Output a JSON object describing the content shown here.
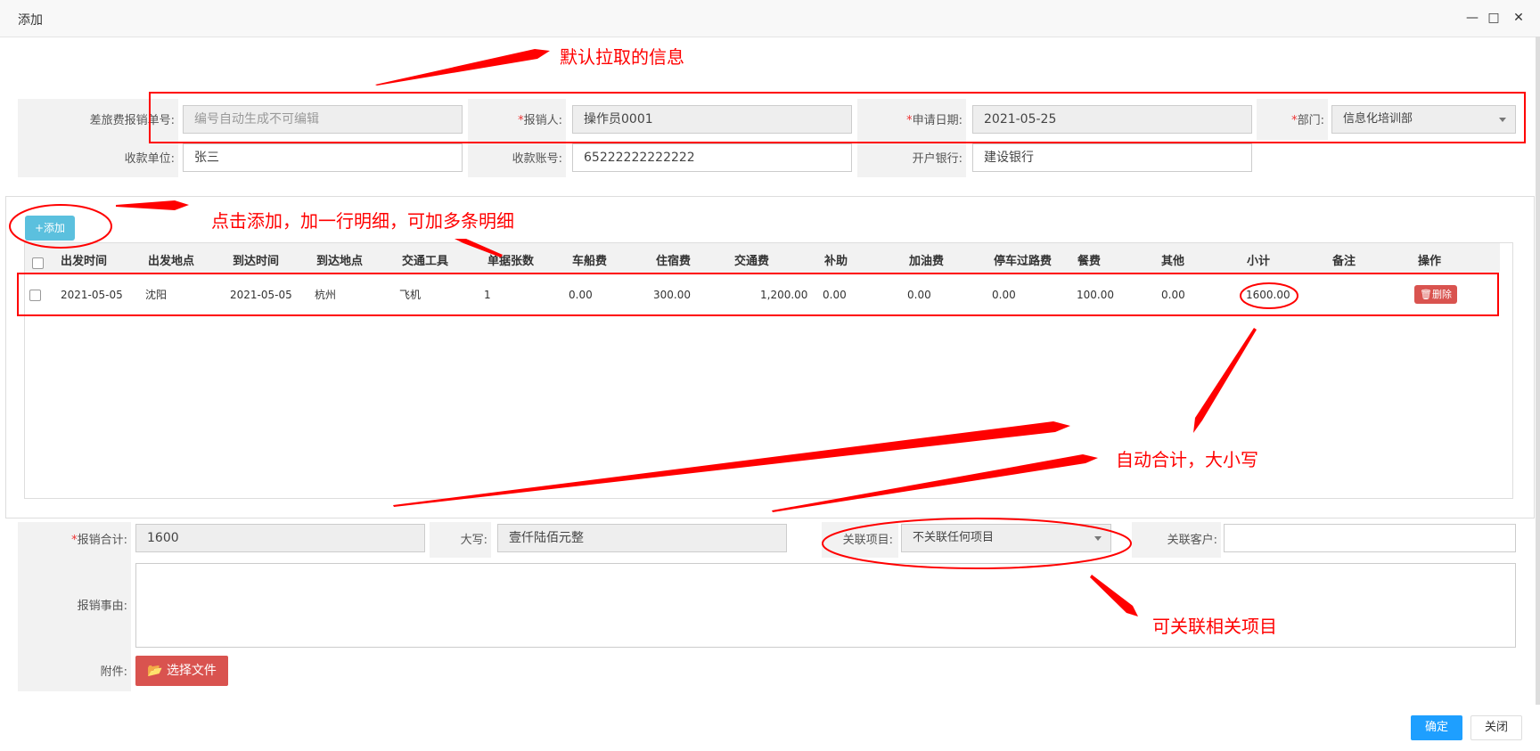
{
  "window": {
    "title": "添加"
  },
  "form": {
    "doc_no_label": "差旅费报销单号:",
    "doc_no_placeholder": "编号自动生成不可编辑",
    "reporter_req": "*",
    "reporter_label": "报销人:",
    "reporter_value": "操作员0001",
    "date_req": "*",
    "date_label": "申请日期:",
    "date_value": "2021-05-25",
    "dept_req": "*",
    "dept_label": "部门:",
    "dept_value": "信息化培训部",
    "payee_label": "收款单位:",
    "payee_value": "张三",
    "account_label": "收款账号:",
    "account_value": "65222222222222",
    "bank_label": "开户银行:",
    "bank_value": "建设银行"
  },
  "detail": {
    "add_button": "+添加",
    "columns": [
      "出发时间",
      "出发地点",
      "到达时间",
      "到达地点",
      "交通工具",
      "单据张数",
      "车船费",
      "住宿费",
      "交通费",
      "补助",
      "加油费",
      "停车过路费",
      "餐费",
      "其他",
      "小计",
      "备注",
      "操作"
    ],
    "rows": [
      {
        "depart_time": "2021-05-05",
        "depart_place": "沈阳",
        "arrive_time": "2021-05-05",
        "arrive_place": "杭州",
        "transport": "飞机",
        "doc_count": "1",
        "vehicle_fee": "0.00",
        "lodging_fee": "300.00",
        "traffic_fee": "1,200.00",
        "subsidy": "0.00",
        "fuel_fee": "0.00",
        "parking_fee": "0.00",
        "meal_fee": "100.00",
        "other_fee": "0.00",
        "subtotal": "1600.00",
        "remark": "",
        "delete_label": "删除"
      }
    ]
  },
  "summary": {
    "total_req": "*",
    "total_label": "报销合计:",
    "total_value": "1600",
    "capital_label": "大写:",
    "capital_value": "壹仟陆佰元整",
    "project_label": "关联项目:",
    "project_value": "不关联任何项目",
    "customer_label": "关联客户:",
    "customer_value": "",
    "reason_label": "报销事由:",
    "attach_label": "附件:",
    "file_button": "选择文件"
  },
  "footer": {
    "ok": "确定",
    "close": "关闭"
  },
  "annotations": {
    "default_info": "默认拉取的信息",
    "add_row": "点击添加，加一行明细，可加多条明细",
    "auto_total": "自动合计，大小写",
    "link_project": "可关联相关项目"
  },
  "colors": {
    "annotation": "#ff0000",
    "primary": "#1e9fff",
    "danger": "#d9534f",
    "info": "#5bc0de"
  }
}
